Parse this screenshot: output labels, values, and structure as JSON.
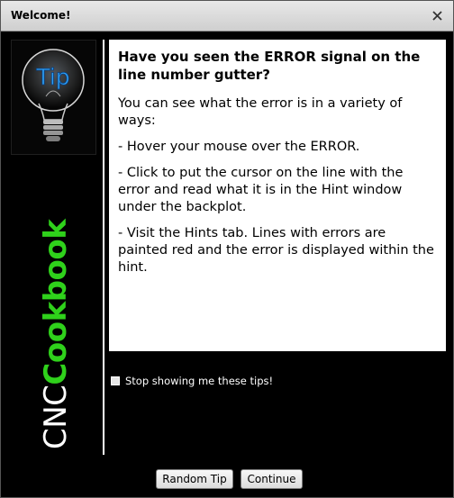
{
  "window": {
    "title": "Welcome!"
  },
  "sidebar": {
    "tip_text": "Tip",
    "brand_cnc": "CNC",
    "brand_cookbook": "Cookbook",
    "accent_color": "#2fd11b"
  },
  "tip": {
    "heading": "Have you seen the ERROR signal on the line number gutter?",
    "paragraphs": [
      "You can see what the error is in a variety of ways:",
      "- Hover your mouse over the ERROR.",
      "- Click to put the cursor on the line with the error and read what it is in the Hint window under the backplot.",
      "- Visit the Hints tab.  Lines with errors are painted red and the error is displayed within the hint."
    ]
  },
  "options": {
    "stop_showing_label": "Stop showing me these tips!",
    "stop_showing_checked": false
  },
  "buttons": {
    "random_tip": "Random Tip",
    "continue": "Continue"
  },
  "icons": {
    "close": "close-icon",
    "lightbulb": "lightbulb-icon"
  }
}
